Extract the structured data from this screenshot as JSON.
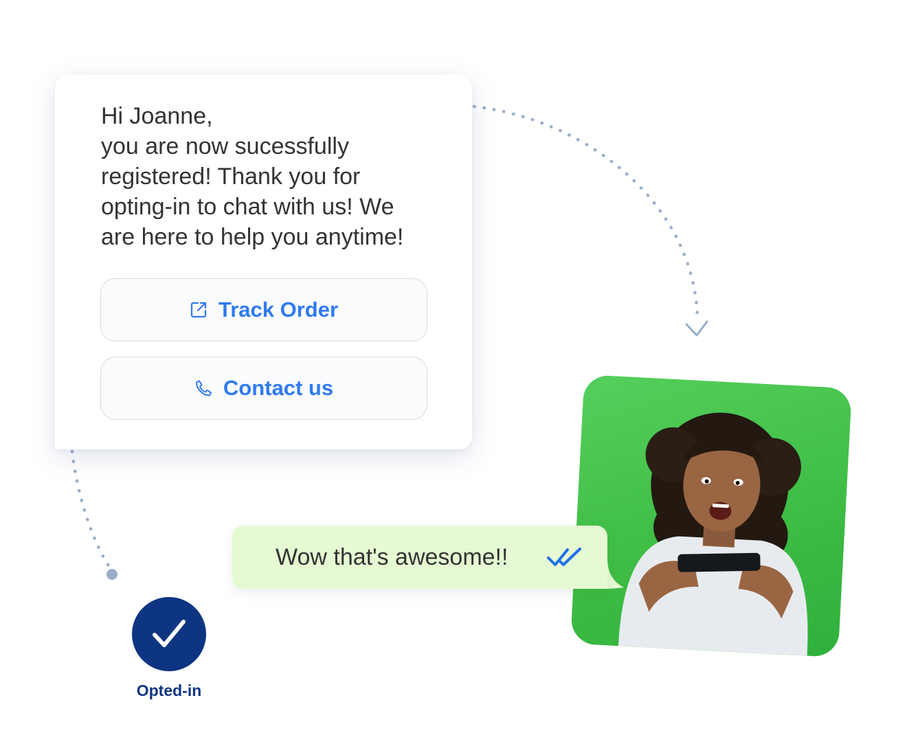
{
  "bot_message": {
    "text": "Hi Joanne,\nyou are now sucessfully\nregistered! Thank you for\nopting-in to chat with us! We\nare here to help you anytime!"
  },
  "quick_replies": [
    {
      "label": "Track Order",
      "icon": "external-link-icon"
    },
    {
      "label": "Contact us",
      "icon": "phone-icon"
    }
  ],
  "user_message": {
    "text": "Wow that's awesome!!",
    "status_icon": "double-check-icon"
  },
  "optin": {
    "label": "Opted-in",
    "icon": "checkmark-icon"
  },
  "colors": {
    "accent_blue": "#2f7af0",
    "navy": "#0d3582",
    "user_bubble": "#e5fad3",
    "photo_green": "#3fbd45",
    "path_dots": "#9aaecb"
  }
}
